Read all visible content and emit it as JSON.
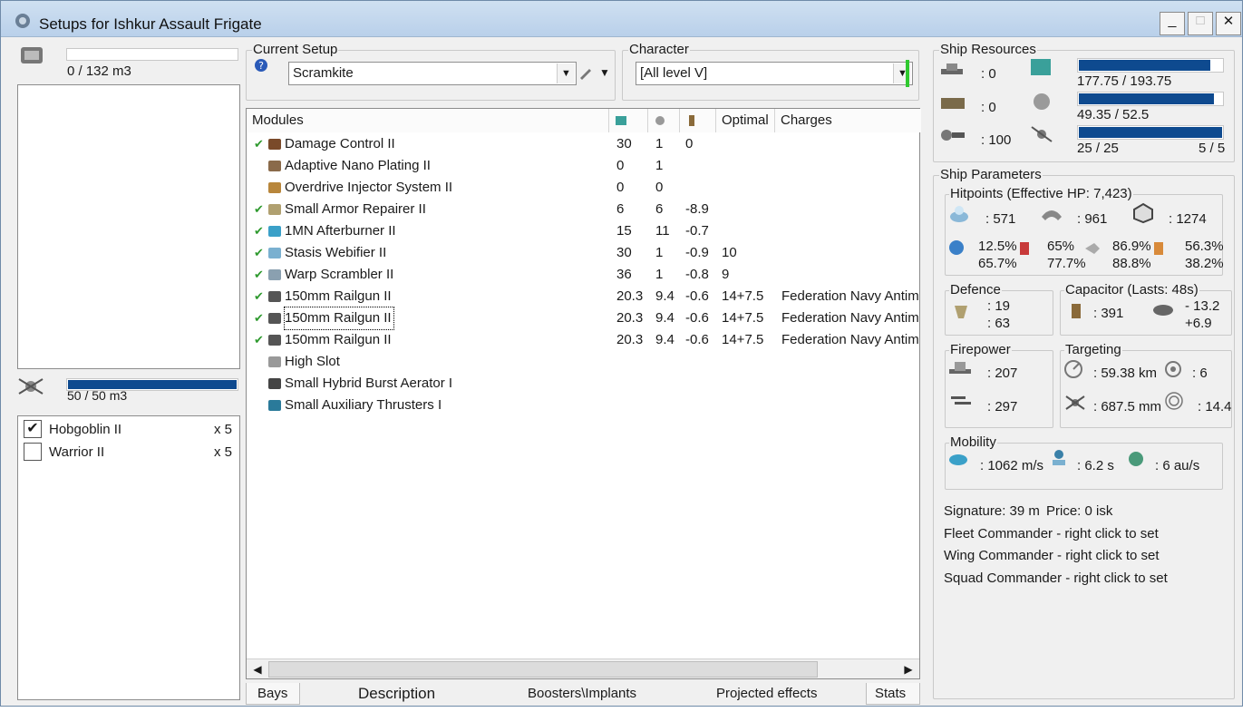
{
  "window": {
    "title": "Setups for Ishkur Assault Frigate",
    "controls": [
      "_",
      "□",
      "✕"
    ]
  },
  "cargo": {
    "usage": "0 / 132 m3",
    "fill": 0.0
  },
  "drones": {
    "usage": "50 / 50 m3",
    "fill": 1.0,
    "items": [
      {
        "name": "Hobgoblin II",
        "qty": "x 5",
        "checked": true
      },
      {
        "name": "Warrior II",
        "qty": "x 5",
        "checked": false
      }
    ]
  },
  "current_setup": {
    "label": "Current Setup",
    "value": "Scramkite"
  },
  "character": {
    "label": "Character",
    "value": "[All level V]"
  },
  "modules": {
    "headers": {
      "name": "Modules",
      "optimal": "Optimal",
      "charges": "Charges"
    },
    "rows": [
      {
        "check": "✔",
        "name": "Damage Control II",
        "cpu": "30",
        "pg": "1",
        "cap": "0",
        "optimal": "",
        "charges": "",
        "color": "#7a4a2a"
      },
      {
        "check": "",
        "name": "Adaptive Nano Plating II",
        "cpu": "0",
        "pg": "1",
        "cap": "",
        "optimal": "",
        "charges": "",
        "color": "#8a6a4a"
      },
      {
        "check": "",
        "name": "Overdrive Injector System II",
        "cpu": "0",
        "pg": "0",
        "cap": "",
        "optimal": "",
        "charges": "",
        "color": "#b8863b"
      },
      {
        "check": "✔",
        "name": "Small Armor Repairer II",
        "cpu": "6",
        "pg": "6",
        "cap": "-8.9",
        "optimal": "",
        "charges": "",
        "color": "#b0a070"
      },
      {
        "check": "✔",
        "name": "1MN Afterburner II",
        "cpu": "15",
        "pg": "11",
        "cap": "-0.7",
        "optimal": "",
        "charges": "",
        "color": "#3aa0c8"
      },
      {
        "check": "✔",
        "name": "Stasis Webifier II",
        "cpu": "30",
        "pg": "1",
        "cap": "-0.9",
        "optimal": "10",
        "charges": "",
        "color": "#7ab0d0"
      },
      {
        "check": "✔",
        "name": "Warp Scrambler II",
        "cpu": "36",
        "pg": "1",
        "cap": "-0.8",
        "optimal": "9",
        "charges": "",
        "color": "#8aa0b0"
      },
      {
        "check": "✔",
        "name": "150mm Railgun II",
        "cpu": "20.3",
        "pg": "9.4",
        "cap": "-0.6",
        "optimal": "14+7.5",
        "charges": "Federation Navy Antim",
        "color": "#555"
      },
      {
        "check": "✔",
        "name": "150mm Railgun II",
        "cpu": "20.3",
        "pg": "9.4",
        "cap": "-0.6",
        "optimal": "14+7.5",
        "charges": "Federation Navy Antim",
        "color": "#555",
        "selected": true
      },
      {
        "check": "✔",
        "name": "150mm Railgun II",
        "cpu": "20.3",
        "pg": "9.4",
        "cap": "-0.6",
        "optimal": "14+7.5",
        "charges": "Federation Navy Antim",
        "color": "#555"
      },
      {
        "check": "",
        "name": "High Slot",
        "cpu": "",
        "pg": "",
        "cap": "",
        "optimal": "",
        "charges": "",
        "color": "#999"
      },
      {
        "check": "",
        "name": "Small Hybrid Burst Aerator I",
        "cpu": "",
        "pg": "",
        "cap": "",
        "optimal": "",
        "charges": "",
        "color": "#444"
      },
      {
        "check": "",
        "name": "Small Auxiliary Thrusters I",
        "cpu": "",
        "pg": "",
        "cap": "",
        "optimal": "",
        "charges": "",
        "color": "#2a7a9a"
      }
    ]
  },
  "tabs": [
    "Bays",
    "Description",
    "Boosters\\Implants",
    "Projected effects",
    "Stats"
  ],
  "ship_resources": {
    "label": "Ship Resources",
    "turrets": ": 0",
    "launchers": ": 0",
    "calibration": ": 100",
    "cpu": {
      "text": "177.75 / 193.75",
      "fill": 0.917
    },
    "powergrid": {
      "text": "49.35 / 52.5",
      "fill": 0.94
    },
    "drone_bw": {
      "text": "25 / 25",
      "fill": 1.0
    },
    "drones_active": "5 / 5"
  },
  "ship_parameters": {
    "label": "Ship Parameters",
    "hitpoints": {
      "label": "Hitpoints (Effective HP: 7,423)",
      "shield": ": 571",
      "armor": ": 961",
      "structure": ": 1274",
      "res": [
        [
          "12.5%",
          "65.7%"
        ],
        [
          "65%",
          "77.7%"
        ],
        [
          "86.9%",
          "88.8%"
        ],
        [
          "56.3%",
          "38.2%"
        ]
      ]
    },
    "defence": {
      "label": "Defence",
      "v1": ": 19",
      "v2": ": 63"
    },
    "capacitor": {
      "label": "Capacitor (Lasts: 48s)",
      "amount": ": 391",
      "d1": "- 13.2",
      "d2": "+6.9"
    },
    "firepower": {
      "label": "Firepower",
      "v1": ": 207",
      "v2": ": 297"
    },
    "targeting": {
      "label": "Targeting",
      "range": ": 59.38 km",
      "targets": ": 6",
      "scanres": ": 687.5 mm",
      "sensor": ": 14.4"
    },
    "mobility": {
      "label": "Mobility",
      "speed": ": 1062 m/s",
      "align": ": 6.2 s",
      "warp": ": 6 au/s"
    },
    "signature": "Signature: 39 m",
    "price": "Price: 0 isk",
    "fleet": "Fleet Commander - right click to set",
    "wing": "Wing Commander - right click to set",
    "squad": "Squad Commander - right click to set"
  }
}
